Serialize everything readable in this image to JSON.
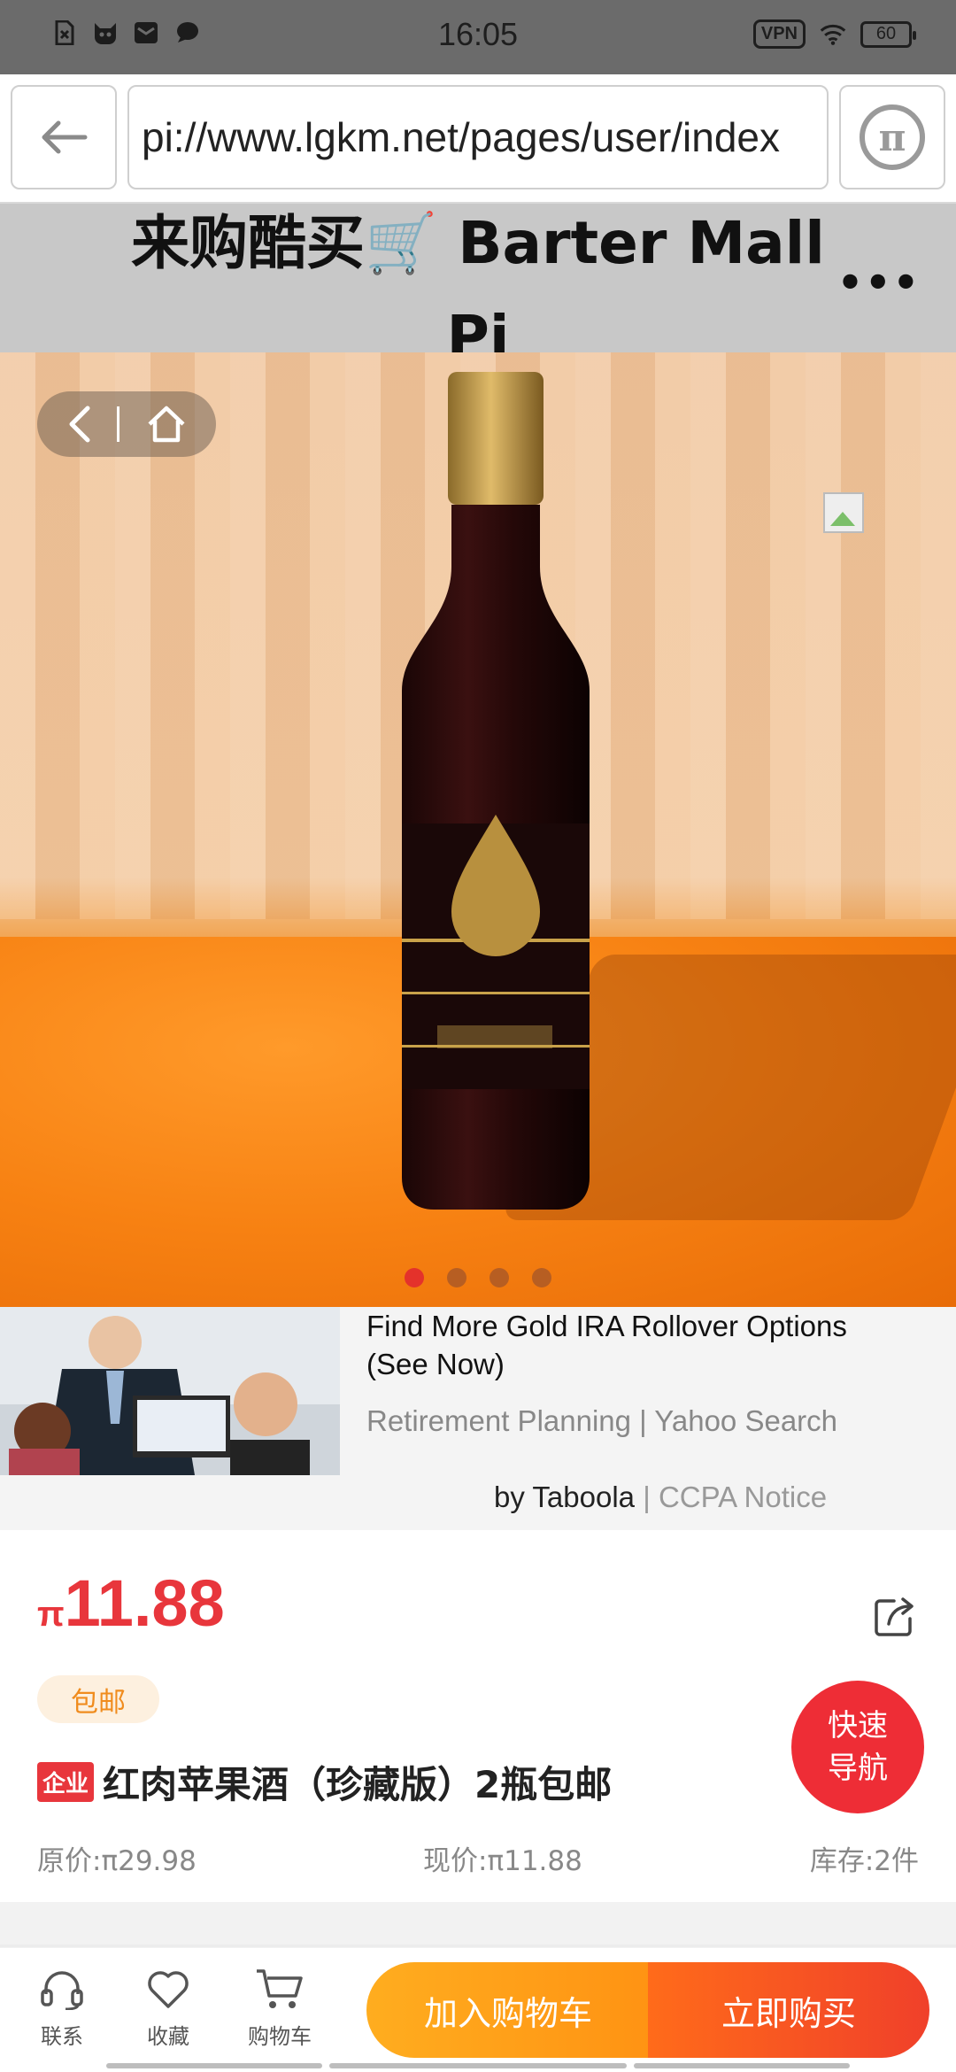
{
  "status_bar": {
    "time": "16:05",
    "vpn_label": "VPN",
    "battery_level": "60"
  },
  "address_bar": {
    "url": "pi://www.lgkm.net/pages/user/index"
  },
  "site": {
    "title": "来购酷买🛒 Barter Mall Pi",
    "more_label": "•••"
  },
  "gallery": {
    "image_count": 4,
    "active_index": 0
  },
  "ad": {
    "headline": "Find More Gold IRA Rollover Options (See Now)",
    "source": "Retirement Planning | Yahoo Search",
    "by": "by Taboola",
    "separator": "|",
    "ccpa": "CCPA Notice"
  },
  "product": {
    "currency": "π",
    "price": "11.88",
    "free_shipping": "包邮",
    "biz_tag": "企业",
    "title": "红肉苹果酒（珍藏版）2瓶包邮",
    "original_price": "原价:π29.98",
    "current_price": "现价:π11.88",
    "stock": "库存:2件"
  },
  "quick_nav": {
    "line1": "快速",
    "line2": "导航"
  },
  "bottom_bar": {
    "contact": "联系",
    "favorite": "收藏",
    "cart": "购物车",
    "add_to_cart": "加入购物车",
    "buy_now": "立即购买"
  },
  "colors": {
    "accent_red": "#e8363c",
    "cart_orange": "#ff9f19",
    "buy_red": "#f0402a"
  }
}
